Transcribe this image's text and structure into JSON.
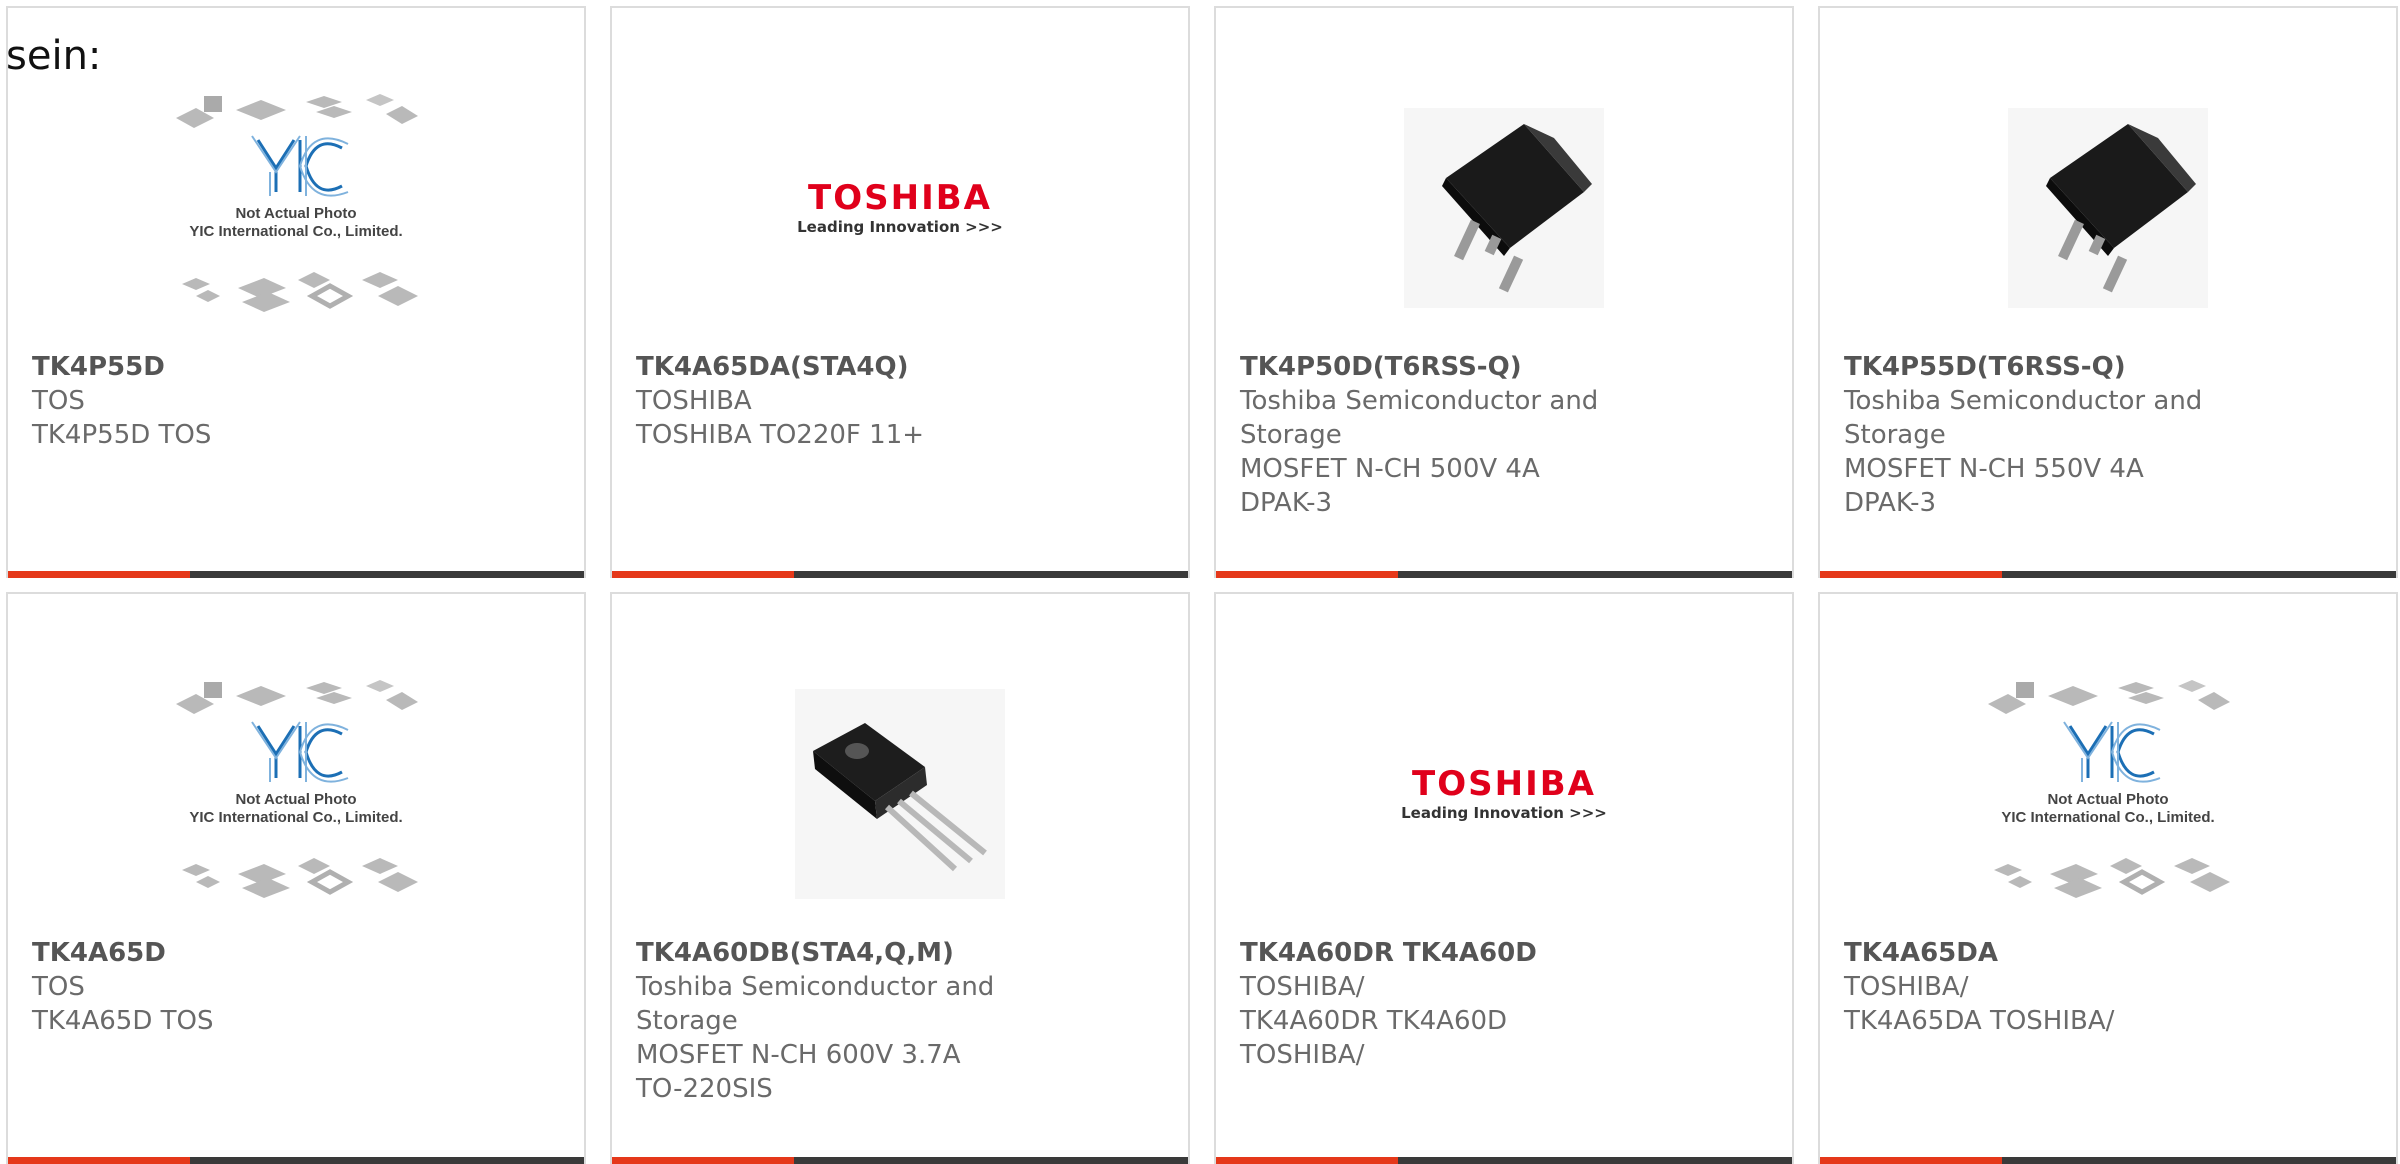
{
  "intro_text": "sein:",
  "products": [
    {
      "part": "TK4P55D",
      "manufacturer": "TOS",
      "description": "TK4P55D TOS",
      "image": "yic-placeholder"
    },
    {
      "part": "TK4A65DA(STA4Q)",
      "manufacturer": "TOSHIBA",
      "description": "TOSHIBA TO220F 11+",
      "image": "toshiba-logo"
    },
    {
      "part": "TK4P50D(T6RSS-Q)",
      "manufacturer": "Toshiba Semiconductor and Storage",
      "description": "MOSFET N-CH 500V 4A DPAK-3",
      "image": "dpak-chip"
    },
    {
      "part": "TK4P55D(T6RSS-Q)",
      "manufacturer": "Toshiba Semiconductor and Storage",
      "description": "MOSFET N-CH 550V 4A DPAK-3",
      "image": "dpak-chip"
    },
    {
      "part": "TK4A65D",
      "manufacturer": "TOS",
      "description": "TK4A65D TOS",
      "image": "yic-placeholder"
    },
    {
      "part": "TK4A60DB(STA4,Q,M)",
      "manufacturer": "Toshiba Semiconductor and Storage",
      "description": "MOSFET N-CH 600V 3.7A TO-220SIS",
      "image": "to220-chip"
    },
    {
      "part": "TK4A60DR TK4A60D",
      "manufacturer": "TOSHIBA/",
      "description": "TK4A60DR TK4A60D TOSHIBA/",
      "image": "toshiba-logo"
    },
    {
      "part": "TK4A65DA",
      "manufacturer": "TOSHIBA/",
      "description": "TK4A65DA TOSHIBA/",
      "image": "yic-placeholder"
    }
  ],
  "logo_text": {
    "toshiba_brand": "TOSHIBA",
    "toshiba_tag": "Leading Innovation >>>",
    "yic_line1": "Not Actual Photo",
    "yic_line2": "YIC International Co., Limited."
  },
  "colors": {
    "accent": "#e5381a",
    "bar": "#3a3a3a",
    "toshiba_red": "#e0001b"
  }
}
